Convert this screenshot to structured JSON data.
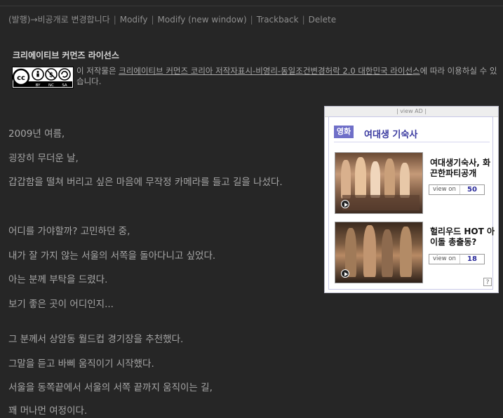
{
  "top_actions": {
    "publish": "(발행)→비공개로 변경합니다",
    "modify": "Modify",
    "modify_new": "Modify (new window)",
    "trackback": "Trackback",
    "delete": "Delete"
  },
  "license": {
    "title": "크리에이티브 커먼즈 라이선스",
    "badge": "cc by nc sa",
    "text_prefix": "이 저작물은 ",
    "link": "크리에이티브 커먼즈 코리아 저작자표시-비영리-동일조건변경허락 2.0 대한민국 라이선스",
    "text_suffix": "에 따라 이용하실 수 있습니다."
  },
  "post": {
    "paragraphs": [
      "2009년 여름,",
      "굉장히 무더운 날,",
      "갑갑함을 떨쳐 버리고 싶은 마음에 무작정 카메라를 들고 길을 나섰다.",
      "어디를 가야할까? 고민하던 중,",
      "내가 잘 가지 않는 서울의 서쪽을 돌아다니고 싶었다.",
      "아는 분께 부탁을 드렸다.",
      "보기 좋은 곳이 어디인지...",
      "그 분께서 상암동 월드컵 경기장을 추천했다.",
      "그말을 듣고 바삐 움직이기 시작했다.",
      "서울을 동쪽끝에서 서울의 서쪽 끝까지 움직이는 길,",
      "꽤 머나먼 여정이다."
    ]
  },
  "ad": {
    "topbar": "| view AD |",
    "category": "영화",
    "title": "여대생 기숙사",
    "items": [
      {
        "headline": "여대생기숙사, 화끈한파티공개",
        "view_label": "view on",
        "count": "50"
      },
      {
        "headline": "헐리우드 HOT 아이돌 총출동?",
        "view_label": "view on",
        "count": "18"
      }
    ],
    "help": "?"
  }
}
